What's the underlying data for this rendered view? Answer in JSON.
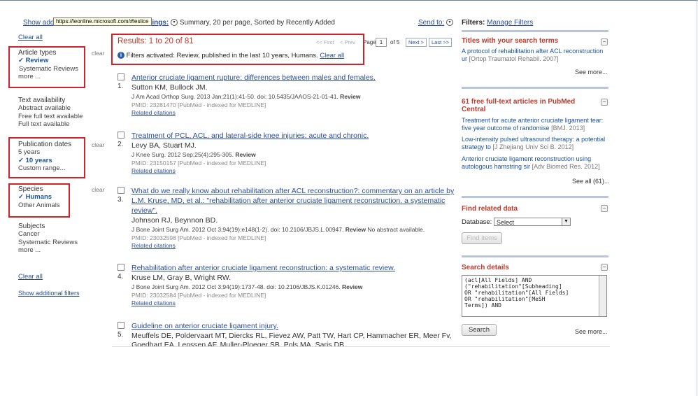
{
  "top": {
    "tooltip": "https://leonline.microsoft.com/#leslice",
    "display_prefix": "Show additi",
    "display_suffix": "ttings:",
    "display_summary": "Summary, 20 per page, Sorted by Recently Added",
    "send_to": "Send to:",
    "filters_label": "Filters:",
    "manage_filters": "Manage Filters"
  },
  "left": {
    "clear_all_top": "Clear all",
    "clear_label": "clear",
    "article_types": {
      "heading": "Article types",
      "items": [
        "Review",
        "Systematic Reviews",
        "more ..."
      ]
    },
    "text_availability": {
      "heading": "Text availability",
      "items": [
        "Abstract available",
        "Free full text available",
        "Full text available"
      ]
    },
    "publication_dates": {
      "heading": "Publication dates",
      "items": [
        "5 years",
        "10 years",
        "Custom range..."
      ]
    },
    "species": {
      "heading": "Species",
      "items": [
        "Humans",
        "Other Animals"
      ]
    },
    "subjects": {
      "heading": "Subjects",
      "items": [
        "Cancer",
        "Systematic Reviews",
        "more ..."
      ]
    },
    "clear_all_bottom": "Clear all",
    "show_additional": "Show additional filters"
  },
  "results": {
    "title": "Results: 1 to 20 of 81",
    "first": "<< First",
    "prev": "< Prev",
    "page_label": "Page",
    "page_value": "1",
    "of_pages": "of 5",
    "next": "Next >",
    "last": "Last >>",
    "filter_msg": "Filters activated: Review, published in the last 10 years, Humans.",
    "filter_clear": "Clear all",
    "items": [
      {
        "num": "1.",
        "title": "Anterior cruciate ligament rupture: differences between males and females.",
        "authors": "Sutton KM, Bullock JM.",
        "journal": "J Am Acad Orthop Surg. 2013 Jan;21(1):41-50. doi: 10.5435/JAAOS-21-01-41.",
        "type": "Review",
        "pmid": "PMID: 23281470 [PubMed - indexed for MEDLINE]",
        "related": "Related citations"
      },
      {
        "num": "2.",
        "title": "Treatment of PCL, ACL, and lateral-side knee injuries: acute and chronic.",
        "authors": "Levy BA, Stuart MJ.",
        "journal": "J Knee Surg. 2012 Sep;25(4):295-305.",
        "type": "Review",
        "pmid": "PMID: 23150157 [PubMed - indexed for MEDLINE]",
        "related": "Related citations"
      },
      {
        "num": "3.",
        "title": "What do we really know about rehabilitation after ACL reconstruction?: commentary on an article by L.M. Kruse, MD, et al.: \"rehabilitation after anterior cruciate ligament reconstruction. a systematic review\".",
        "authors": "Johnson RJ, Beynnon BD.",
        "journal": "J Bone Joint Surg Am. 2012 Oct 3;94(19):e148(1-2). doi: 10.2106/JBJS.L.00947.",
        "type": "Review",
        "extra": "No abstract available.",
        "pmid": "PMID: 23032598 [PubMed - indexed for MEDLINE]",
        "related": "Related citations"
      },
      {
        "num": "4.",
        "title": "Rehabilitation after anterior cruciate ligament reconstruction: a systematic review.",
        "authors": "Kruse LM, Gray B, Wright RW.",
        "journal": "J Bone Joint Surg Am. 2012 Oct 3;94(19):1737-48. doi: 10.2106/JBJS.K.01246.",
        "type": "Review",
        "pmid": "PMID: 23032584 [PubMed - indexed for MEDLINE]",
        "related": "Related citations"
      },
      {
        "num": "5.",
        "title": "Guideline on anterior cruciate ligament injury.",
        "authors": "Meuffels DE, Poldervaart MT, Diercks RL, Fievez AW, Patt TW, Hart CP, Hammacher ER, Meer Fv,",
        "authors2": "Goedhart EA, Lenssen AF, Muller-Ploeger SB, Pols MA, Saris DB."
      }
    ]
  },
  "right": {
    "titles_heading": "Titles with your search terms",
    "titles_text": "A protocol of rehabilitation after ACL reconstruction ur",
    "titles_src": "[Ortop Traumatol Rehabil. 2007]",
    "see_more": "See more...",
    "free_heading_1": "61 free full-text articles in PubMed",
    "free_heading_2": "Central",
    "free_items": [
      {
        "text": "Treatment for acute anterior cruciate ligament tear: five year outcome of randomise",
        "src": "[BMJ. 2013]"
      },
      {
        "text": "Low-intensity pulsed ultrasound therapy: a potential strategy to",
        "src": "[J Zhejiang Univ Sci B. 2012]"
      },
      {
        "text": "Anterior cruciate ligament reconstruction using autologous hamstring sir",
        "src": "[Adv Biomed Res. 2012]"
      }
    ],
    "see_all": "See all (61)...",
    "related_heading": "Find related data",
    "database_label": "Database:",
    "database_value": "Select",
    "find_items": "Find items",
    "search_details_heading": "Search details",
    "query": "(acl[All Fields] AND\n(\"rehabilitation\"[Subheading]\nOR \"rehabilitation\"[All Fields]\nOR \"rehabilitation\"[MeSH\nTerms]) AND",
    "search_button": "Search",
    "see_more_2": "See more..."
  }
}
